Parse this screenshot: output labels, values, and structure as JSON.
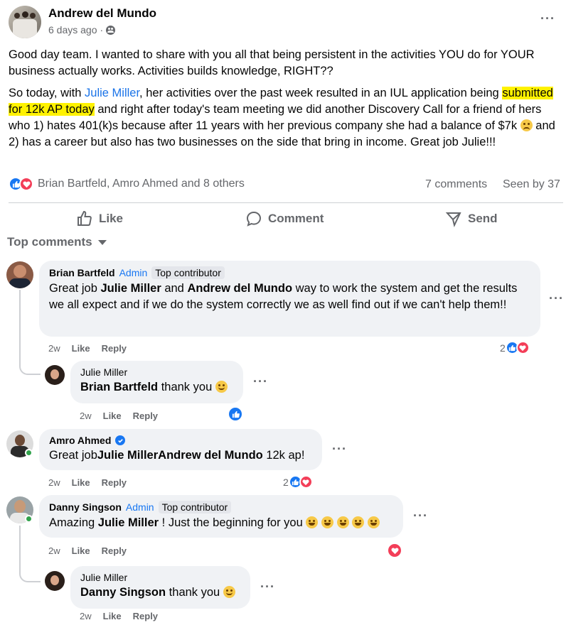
{
  "post": {
    "author": "Andrew del Mundo",
    "time": "6 days ago",
    "privacy_icon": "group-icon",
    "paragraph1": "Good day team. I wanted to share with you all that being persistent in the activities YOU do for YOUR business actually works.  Activities builds knowledge, RIGHT??",
    "p2_prefix": "So today, with ",
    "p2_mention": "Julie Miller",
    "p2_mid": ", her activities over the past week resulted in an IUL application being ",
    "p2_highlight": "submitted for 12k AP today",
    "p2_rest": " and right after today's team meeting we did another Discovery Call for a friend of hers who 1) hates 401(k)s because after 11 years with her previous company she had a balance of $7k ",
    "p2_end": " and 2) has a career but also has two businesses on the side that bring in income. Great job Julie!!!",
    "reactions_text": "Brian Bartfeld, Amro Ahmed and 8 others",
    "comments_count": "7 comments",
    "seen_by": "Seen by 37"
  },
  "actions": {
    "like": "Like",
    "comment": "Comment",
    "send": "Send"
  },
  "sort_label": "Top comments",
  "comments": [
    {
      "author": "Brian Bartfeld",
      "admin": "Admin",
      "badge": "Top contributor",
      "t1": "Great job ",
      "m1": "Julie Miller",
      "t2": " and ",
      "m2": "Andrew del Mundo",
      "t3": " way to work the system and get the results we all expect and if we do the system correctly we as well find out if we can't help them!!",
      "time": "2w",
      "like": "Like",
      "reply": "Reply",
      "reaction_count": "2"
    },
    {
      "author": "Julie Miller",
      "m1": "Brian Bartfeld",
      "t1": " thank you ",
      "time": "2w",
      "like": "Like",
      "reply": "Reply"
    },
    {
      "author": "Amro Ahmed",
      "t1": "Great job",
      "m1": "Julie Miller",
      "m2": "Andrew del Mundo",
      "t2": " 12k ap!",
      "time": "2w",
      "like": "Like",
      "reply": "Reply",
      "reaction_count": "2"
    },
    {
      "author": "Danny Singson",
      "admin": "Admin",
      "badge": "Top contributor",
      "t1": "Amazing ",
      "m1": "Julie Miller",
      "t2": " ! Just the beginning for you ",
      "time": "2w",
      "like": "Like",
      "reply": "Reply"
    },
    {
      "author": "Julie Miller",
      "m1": "Danny Singson",
      "t1": " thank you ",
      "time": "2w",
      "like": "Like",
      "reply": "Reply"
    }
  ],
  "colors": {
    "link": "#1a73e8",
    "highlight": "#fff200",
    "like": "#1877f2",
    "love": "#f33e58",
    "muted": "#65676b"
  }
}
